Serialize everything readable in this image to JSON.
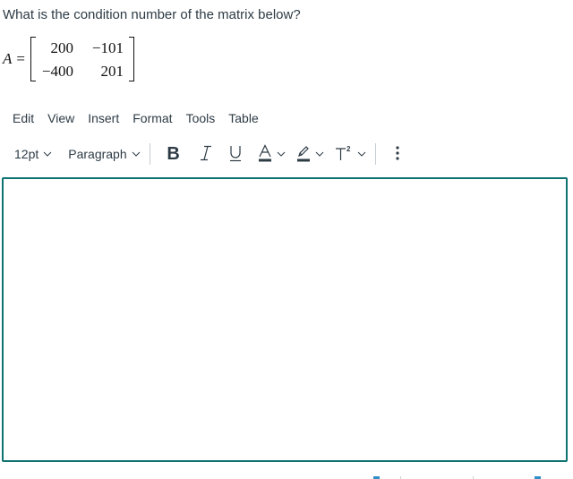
{
  "question": {
    "text": "What is the condition number of the matrix below?"
  },
  "matrix": {
    "variable": "A",
    "equals": "=",
    "rows": [
      [
        "200",
        "−101"
      ],
      [
        "−400",
        "201"
      ]
    ]
  },
  "menubar": {
    "items": [
      "Edit",
      "View",
      "Insert",
      "Format",
      "Tools",
      "Table"
    ]
  },
  "toolbar": {
    "font_size": "12pt",
    "block_format": "Paragraph",
    "bold_label": "B",
    "italic_icon": "italic-icon",
    "underline_icon": "underline-icon",
    "text_color_icon": "text-color-icon",
    "highlight_icon": "highlight-pen-icon",
    "superscript_icon": "superscript-icon",
    "more_icon": "more-vertical-icon"
  },
  "editor": {
    "content": "",
    "border_color": "#0e7370"
  }
}
